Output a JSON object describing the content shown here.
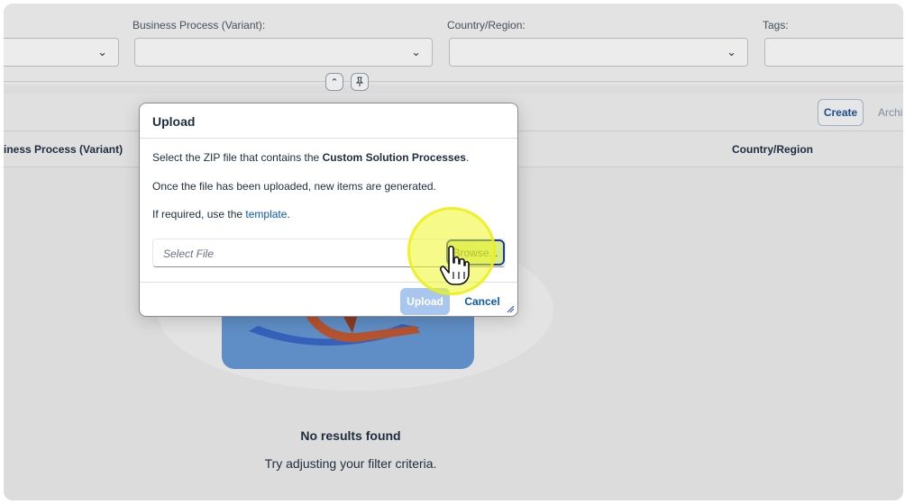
{
  "filters": {
    "business_process_label": "Business Process (Variant):",
    "country_label": "Country/Region:",
    "tags_label": "Tags:"
  },
  "toolbar": {
    "create_label": "Create",
    "archive_label": "Archi"
  },
  "table": {
    "columns": [
      "iness Process (Variant)",
      "Country/Region"
    ]
  },
  "empty_state": {
    "title": "No results found",
    "subtitle": "Try adjusting your filter criteria."
  },
  "dialog": {
    "title": "Upload",
    "line1_prefix": "Select the ZIP file that contains the ",
    "line1_bold": "Custom Solution Processes",
    "line1_suffix": ".",
    "line2": "Once the file has been uploaded, new items are generated.",
    "line3_prefix": "If required, use the ",
    "line3_link": "template",
    "line3_suffix": ".",
    "file_placeholder": "Select File",
    "browse_label": "Browse...",
    "upload_label": "Upload",
    "cancel_label": "Cancel"
  },
  "icons": {
    "chevron_down": "chevron-down-icon",
    "collapse": "chevron-up-icon",
    "pin": "pin-icon",
    "cursor": "hand-pointer-icon"
  },
  "colors": {
    "accent": "#0a58b8",
    "highlight": "#ecf528",
    "upload_disabled": "#a9c7ee"
  }
}
